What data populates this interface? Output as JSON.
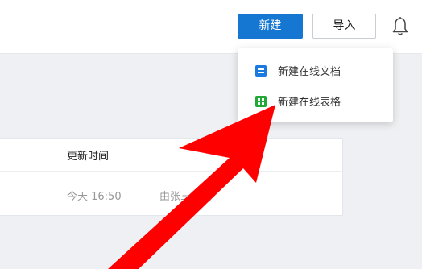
{
  "header": {
    "new_button_label": "新建",
    "import_button_label": "导入",
    "bell_icon": "bell-icon"
  },
  "table": {
    "column_header_time": "更新时间",
    "rows": [
      {
        "time": "今天 16:50",
        "editor": "由张三编辑"
      }
    ]
  },
  "dropdown": {
    "items": [
      {
        "label": "新建在线文档",
        "icon": "doc-icon"
      },
      {
        "label": "新建在线表格",
        "icon": "sheet-icon"
      }
    ]
  },
  "colors": {
    "primary": "#1677d2",
    "doc_icon": "#1a7ae0",
    "sheet_icon": "#21a836",
    "annotation_arrow": "#ff0000"
  }
}
